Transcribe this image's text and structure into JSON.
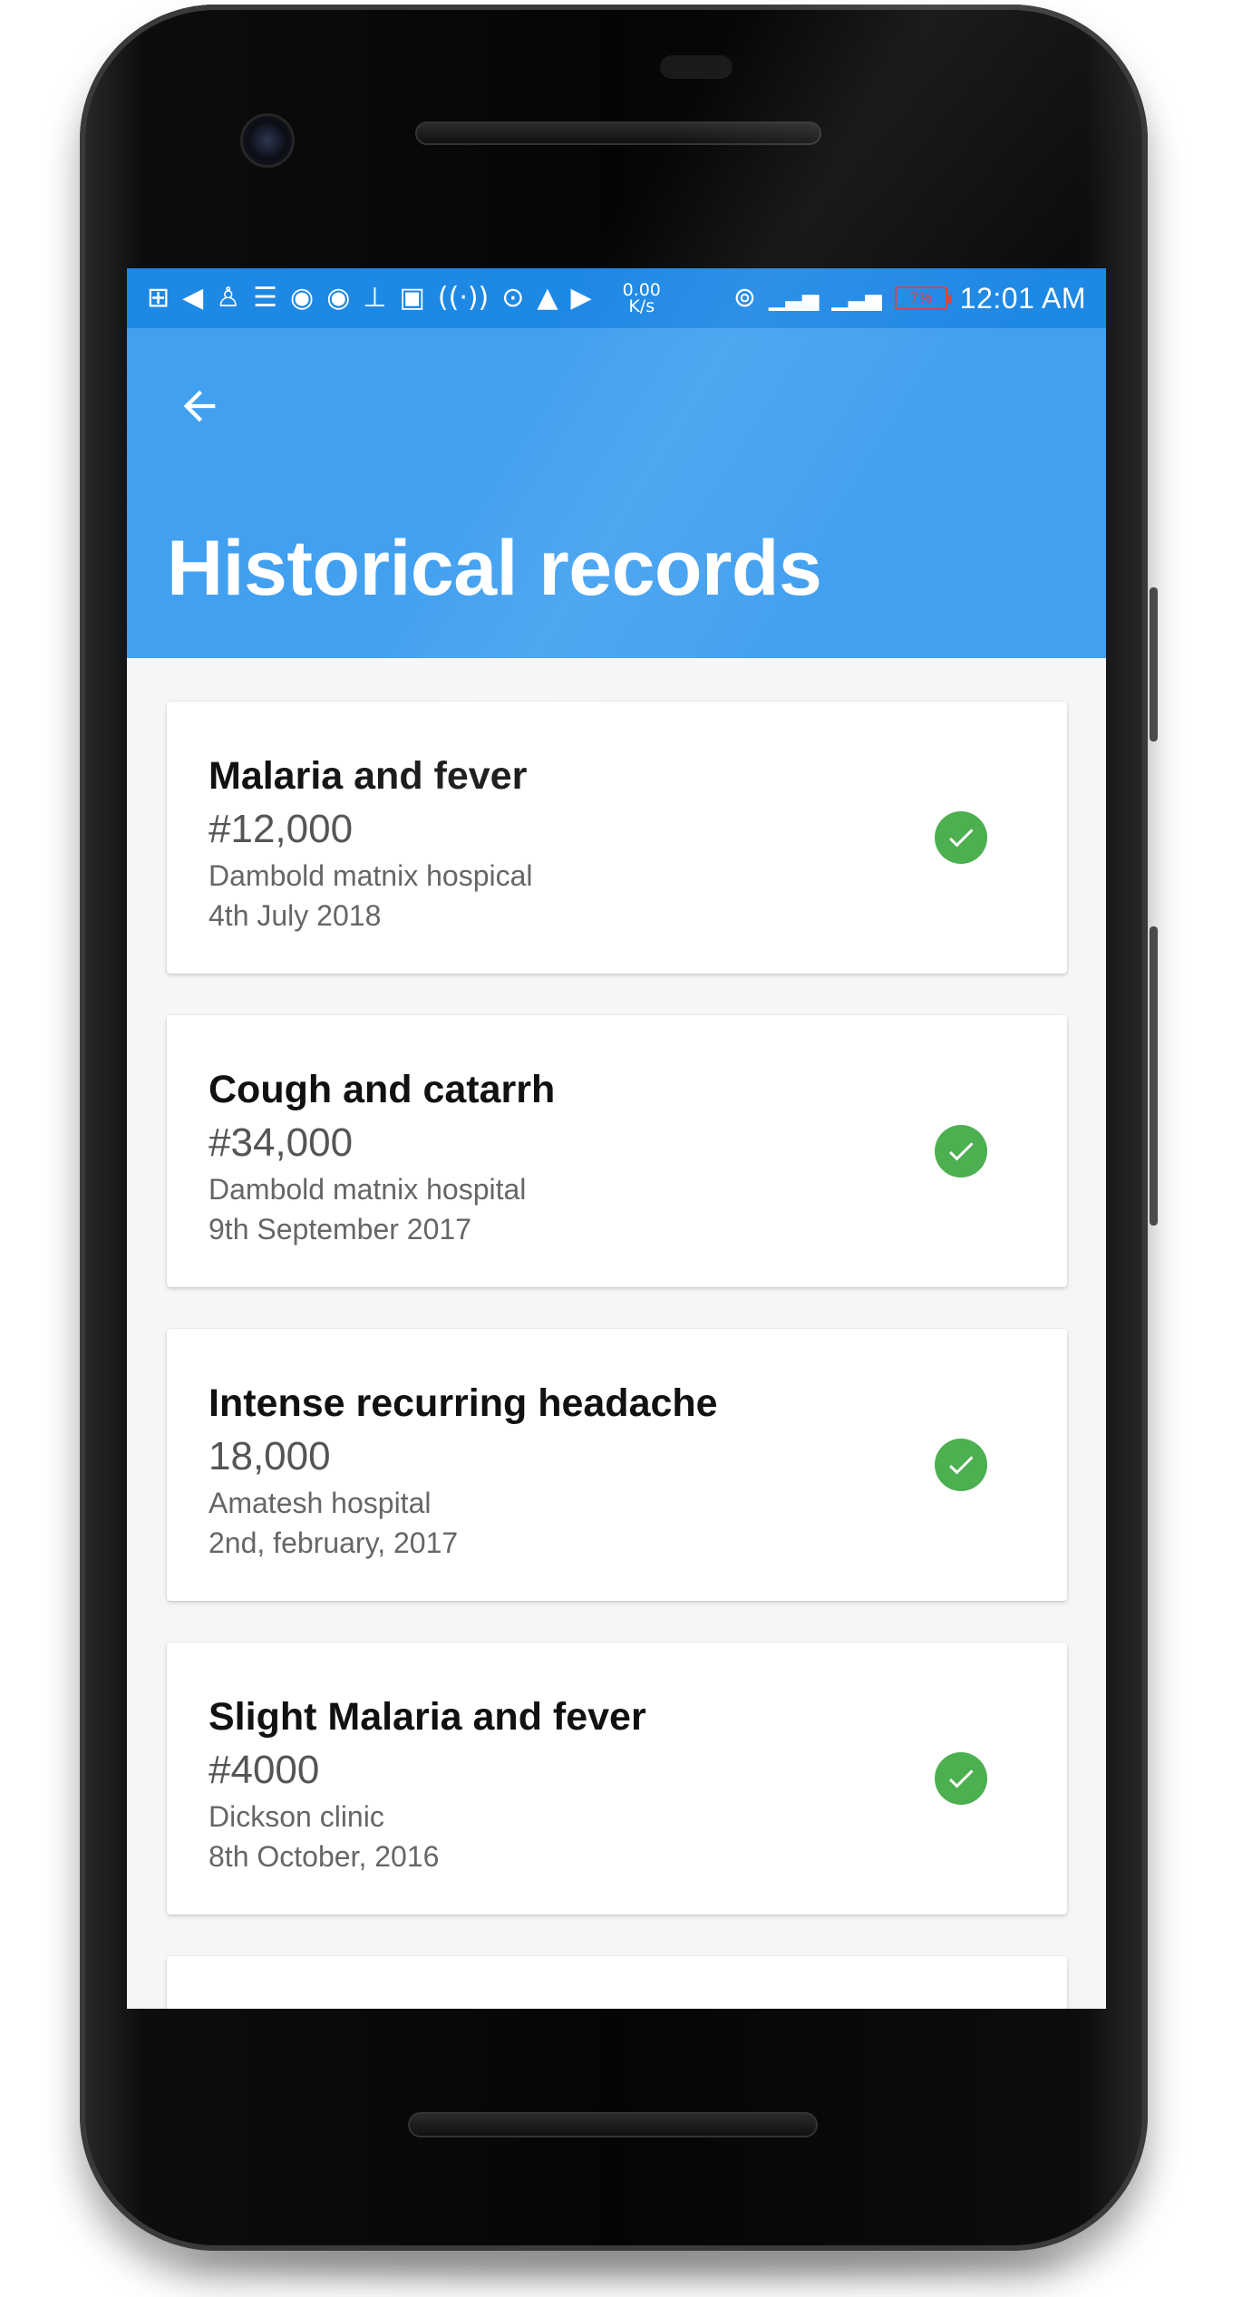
{
  "status_bar": {
    "notification_icons": [
      "add-box-icon",
      "telegram-icon",
      "shirt-icon",
      "message-icon",
      "telegram-icon",
      "telegram-icon",
      "broom-icon",
      "image-icon",
      "broadcast-icon",
      "chat-bubble-icon",
      "warning-icon",
      "youtube-icon"
    ],
    "net_speed_value": "0.00",
    "net_speed_unit": "K/s",
    "battery": "7%",
    "time": "12:01 AM"
  },
  "app_bar": {
    "title": "Historical records"
  },
  "records": [
    {
      "title": "Malaria and fever",
      "amount": "#12,000",
      "place": "Dambold matnix hospical",
      "date": "4th July 2018",
      "status": "paid"
    },
    {
      "title": "Cough and catarrh",
      "amount": "#34,000",
      "place": "Dambold matnix hospital",
      "date": "9th September 2017",
      "status": "paid"
    },
    {
      "title": "Intense recurring headache",
      "amount": "18,000",
      "place": "Amatesh hospital",
      "date": "2nd, february, 2017",
      "status": "paid"
    },
    {
      "title": "Slight Malaria and fever",
      "amount": "#4000",
      "place": "Dickson clinic",
      "date": "8th October, 2016",
      "status": "paid"
    }
  ],
  "colors": {
    "status_bar": "#1e88e5",
    "app_bar": "#42a0f0",
    "check": "#4caf50",
    "battery_low": "#e53935"
  }
}
